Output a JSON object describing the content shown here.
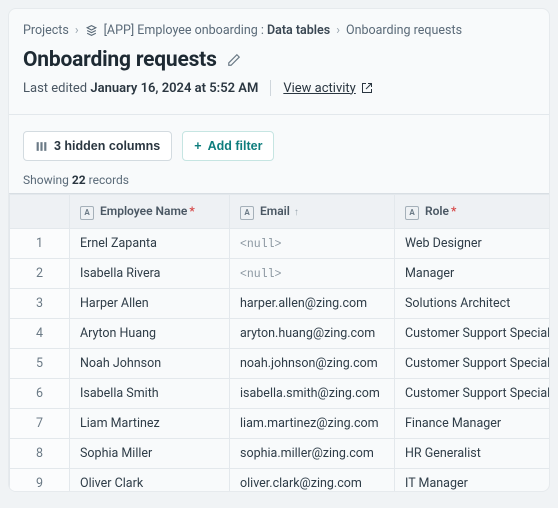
{
  "breadcrumb": {
    "root": "Projects",
    "project_prefix": "[APP]",
    "project": "Employee onboarding",
    "section": "Data tables",
    "page": "Onboarding requests"
  },
  "title": "Onboarding requests",
  "last_edited_label": "Last edited",
  "last_edited_value": "January 16, 2024 at 5:52 AM",
  "view_activity": "View activity",
  "hidden_columns_label": "3 hidden columns",
  "add_filter_label": "Add filter",
  "showing_prefix": "Showing",
  "record_count": "22",
  "showing_suffix": "records",
  "columns": {
    "c1": {
      "label": "Employee Name",
      "required": true
    },
    "c2": {
      "label": "Email",
      "required": false,
      "sorted": true
    },
    "c3": {
      "label": "Role",
      "required": true
    }
  },
  "rows": [
    {
      "n": "1",
      "name": "Ernel Zapanta",
      "email": "<null>",
      "null": true,
      "role": "Web Designer"
    },
    {
      "n": "2",
      "name": "Isabella Rivera",
      "email": "<null>",
      "null": true,
      "role": "Manager"
    },
    {
      "n": "3",
      "name": "Harper Allen",
      "email": "harper.allen@zing.com",
      "null": false,
      "role": "Solutions Architect"
    },
    {
      "n": "4",
      "name": "Aryton Huang",
      "email": "aryton.huang@zing.com",
      "null": false,
      "role": "Customer Support Specialist"
    },
    {
      "n": "5",
      "name": "Noah Johnson",
      "email": "noah.johnson@zing.com",
      "null": false,
      "role": "Customer Support Specialist"
    },
    {
      "n": "6",
      "name": "Isabella Smith",
      "email": "isabella.smith@zing.com",
      "null": false,
      "role": "Customer Support Specialist"
    },
    {
      "n": "7",
      "name": "Liam Martinez",
      "email": "liam.martinez@zing.com",
      "null": false,
      "role": "Finance Manager"
    },
    {
      "n": "8",
      "name": "Sophia Miller",
      "email": "sophia.miller@zing.com",
      "null": false,
      "role": "HR Generalist"
    },
    {
      "n": "9",
      "name": "Oliver Clark",
      "email": "oliver.clark@zing.com",
      "null": false,
      "role": "IT Manager"
    }
  ]
}
